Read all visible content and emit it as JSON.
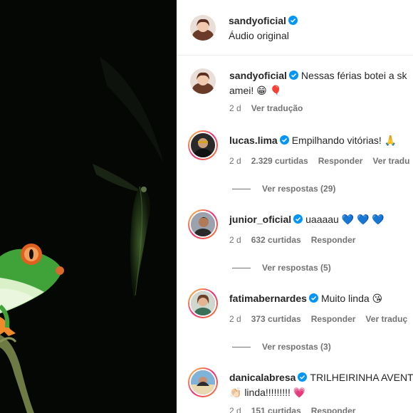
{
  "post": {
    "author": "sandyoficial",
    "audio": "Áudio original"
  },
  "caption": {
    "author": "sandyoficial",
    "text_line1": "Nessas férias botei a sk",
    "text_line2": "amei! 😁 🎈",
    "age": "2 d",
    "translate": "Ver tradução"
  },
  "comments": [
    {
      "author": "lucas.lima",
      "text": "Empilhando vitórias! 🙏 ",
      "age": "2 d",
      "likes": "2.329 curtidas",
      "reply": "Responder",
      "translate": "Ver tradu",
      "replies": "Ver respostas (29)"
    },
    {
      "author": "junior_oficial",
      "text": "uaaaau 💙 💙 💙",
      "age": "2 d",
      "likes": "632 curtidas",
      "reply": "Responder",
      "translate": "",
      "replies": "Ver respostas (5)"
    },
    {
      "author": "fatimabernardes",
      "text": "Muito linda 😘",
      "age": "2 d",
      "likes": "373 curtidas",
      "reply": "Responder",
      "translate": "Ver traduç",
      "replies": "Ver respostas (3)"
    },
    {
      "author": "danicalabresa",
      "text": "TRILHEIRINHA AVENT",
      "text_line2": "👏🏻 linda!!!!!!!!! 💗",
      "age": "2 d",
      "likes": "151 curtidas",
      "reply": "Responder"
    }
  ],
  "colors": {
    "verified": "#0095f6",
    "muted": "#737373",
    "text": "#262626"
  }
}
